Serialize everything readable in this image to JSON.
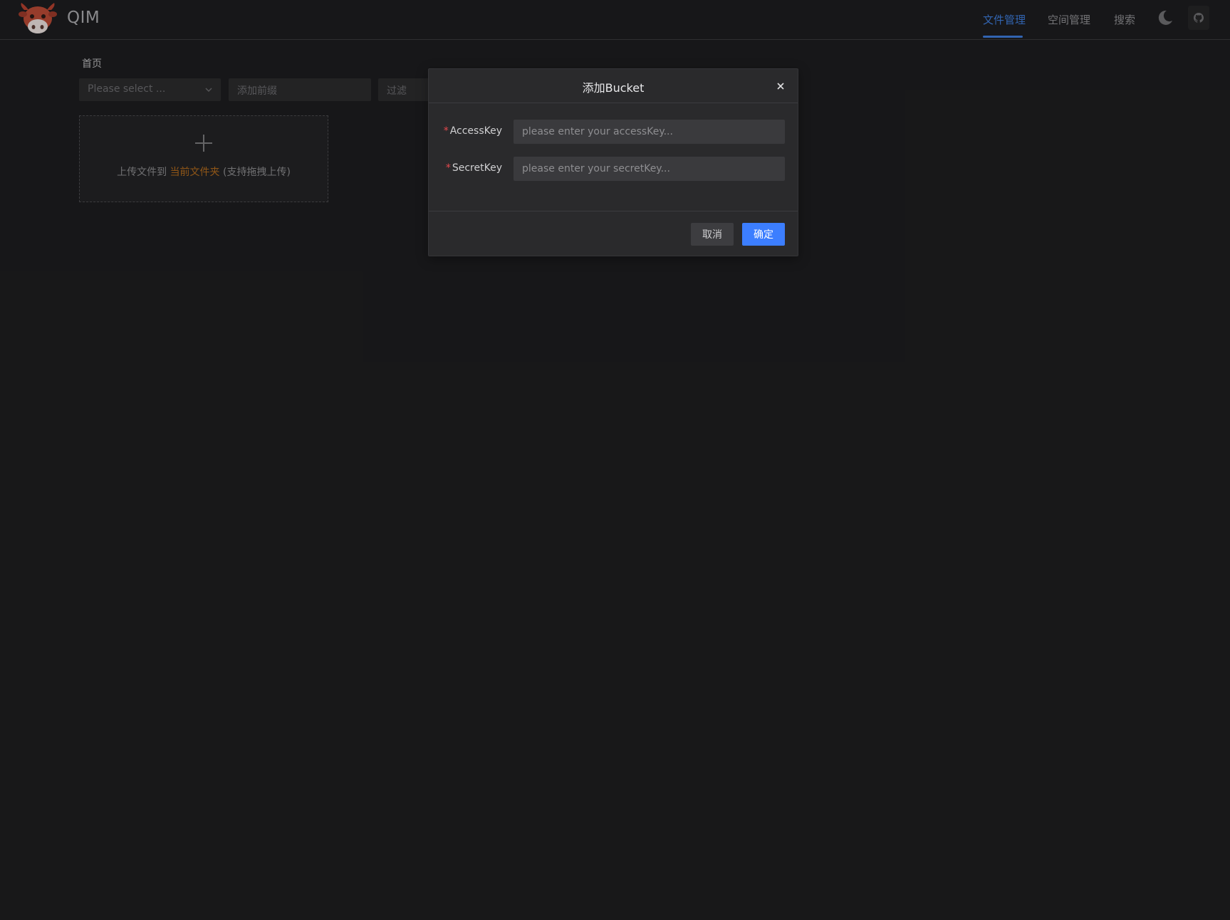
{
  "header": {
    "brand": "QIM",
    "nav": [
      {
        "label": "文件管理",
        "active": true
      },
      {
        "label": "空间管理",
        "active": false
      },
      {
        "label": "搜索",
        "active": false
      }
    ],
    "icons": {
      "logo": "cow-mascot-logo",
      "theme": "moon-icon",
      "repo": "github-icon"
    },
    "accent_color": "#3d7bd8"
  },
  "main": {
    "breadcrumb": "首页",
    "bucket_select": {
      "placeholder": "Please select ..."
    },
    "prefix_input": {
      "placeholder": "添加前缀"
    },
    "filter_input": {
      "placeholder": "过滤"
    },
    "upload": {
      "text_before": "上传文件到",
      "highlight": "当前文件夹",
      "text_after": "(支持拖拽上传)",
      "highlight_color": "#b06a1d"
    }
  },
  "modal": {
    "title": "添加Bucket",
    "fields": [
      {
        "label": "AccessKey",
        "required": true,
        "value": "",
        "placeholder": "please enter your accessKey..."
      },
      {
        "label": "SecretKey",
        "required": true,
        "value": "",
        "placeholder": "please enter your secretKey..."
      }
    ],
    "required_mark": "*",
    "cancel_label": "取消",
    "ok_label": "确定",
    "ok_color": "#3c7eff"
  }
}
